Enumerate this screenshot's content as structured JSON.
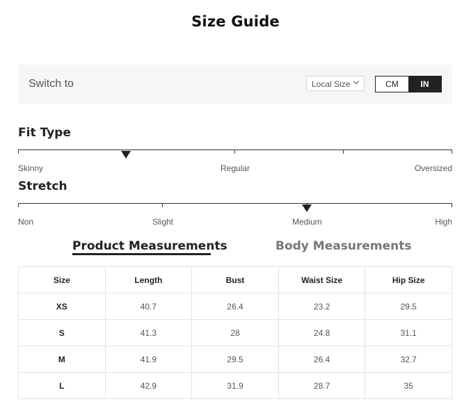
{
  "title": "Size Guide",
  "switch": {
    "label": "Switch to",
    "local_size": "Local Size",
    "units": [
      "CM",
      "IN"
    ],
    "active_unit": "IN"
  },
  "fit_type": {
    "heading": "Fit Type",
    "labels": [
      "Skinny",
      "Regular",
      "Oversized"
    ],
    "pointer_value": "Between Skinny and Regular"
  },
  "stretch": {
    "heading": "Stretch",
    "labels": [
      "Non",
      "Slight",
      "Medium",
      "High"
    ],
    "pointer_value": "Medium"
  },
  "tabs": [
    {
      "label": "Product Measurements",
      "active": true
    },
    {
      "label": "Body Measurements",
      "active": false
    }
  ],
  "table": {
    "headers": [
      "Size",
      "Length",
      "Bust",
      "Waist Size",
      "Hip Size"
    ],
    "rows": [
      [
        "XS",
        "40.7",
        "26.4",
        "23.2",
        "29.5"
      ],
      [
        "S",
        "41.3",
        "28",
        "24.8",
        "31.1"
      ],
      [
        "M",
        "41.9",
        "29.5",
        "26.4",
        "32.7"
      ],
      [
        "L",
        "42.9",
        "31.9",
        "28.7",
        "35"
      ]
    ]
  },
  "colors": {
    "accent": "#222222",
    "bar_background": "#f6f6f6",
    "inactive_tab": "#777777"
  }
}
